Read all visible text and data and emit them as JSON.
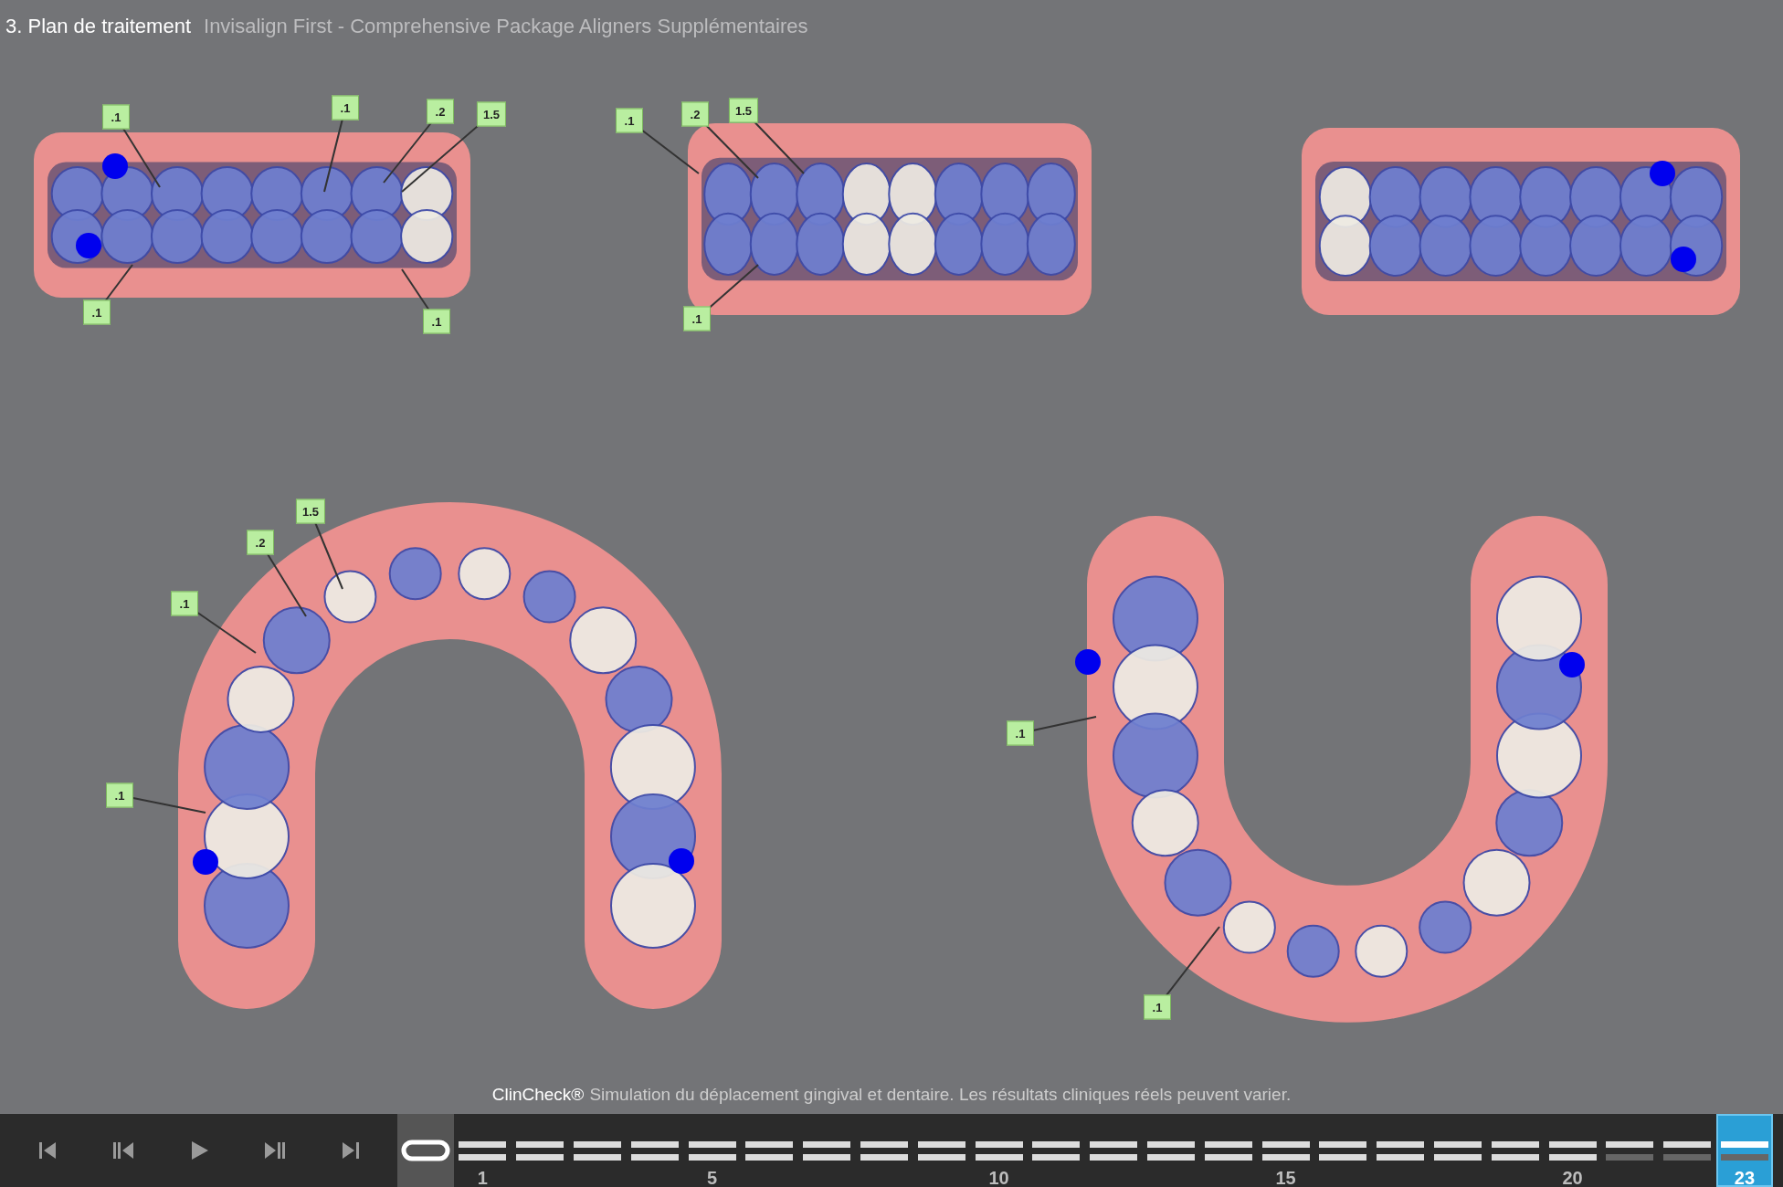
{
  "header": {
    "step": "3. Plan de traitement",
    "title": "Invisalign First - Comprehensive Package Aligners Supplémentaires"
  },
  "views": [
    {
      "kind": "side",
      "labels": [
        ".1",
        ".1",
        ".2",
        "1.5",
        ".1",
        ".1"
      ]
    },
    {
      "kind": "front",
      "labels": [
        ".1",
        ".2",
        "1.5",
        ".1"
      ]
    },
    {
      "kind": "side"
    },
    {
      "kind": "upper",
      "labels": [
        "1.5",
        ".2",
        ".1",
        ".1"
      ]
    },
    {
      "kind": "lower",
      "labels": [
        ".1",
        ".1"
      ]
    }
  ],
  "disclaimer": {
    "brand": "ClinCheck®",
    "text": "Simulation du déplacement gingival et dentaire. Les résultats cliniques réels peuvent varier."
  },
  "stages": [
    {
      "kind": "start",
      "selected": false
    },
    {
      "kind": "aligner",
      "label": "1",
      "selected": false,
      "upper": true,
      "lower": true
    },
    {
      "kind": "aligner",
      "selected": false,
      "upper": true,
      "lower": true
    },
    {
      "kind": "aligner",
      "selected": false,
      "upper": true,
      "lower": true
    },
    {
      "kind": "aligner",
      "selected": false,
      "upper": true,
      "lower": true
    },
    {
      "kind": "aligner",
      "label": "5",
      "selected": false,
      "upper": true,
      "lower": true
    },
    {
      "kind": "aligner",
      "selected": false,
      "upper": true,
      "lower": true
    },
    {
      "kind": "aligner",
      "selected": false,
      "upper": true,
      "lower": true
    },
    {
      "kind": "aligner",
      "selected": false,
      "upper": true,
      "lower": true
    },
    {
      "kind": "aligner",
      "selected": false,
      "upper": true,
      "lower": true
    },
    {
      "kind": "aligner",
      "label": "10",
      "selected": false,
      "upper": true,
      "lower": true
    },
    {
      "kind": "aligner",
      "selected": false,
      "upper": true,
      "lower": true
    },
    {
      "kind": "aligner",
      "selected": false,
      "upper": true,
      "lower": true
    },
    {
      "kind": "aligner",
      "selected": false,
      "upper": true,
      "lower": true
    },
    {
      "kind": "aligner",
      "selected": false,
      "upper": true,
      "lower": true
    },
    {
      "kind": "aligner",
      "label": "15",
      "selected": false,
      "upper": true,
      "lower": true
    },
    {
      "kind": "aligner",
      "selected": false,
      "upper": true,
      "lower": true
    },
    {
      "kind": "aligner",
      "selected": false,
      "upper": true,
      "lower": true
    },
    {
      "kind": "aligner",
      "selected": false,
      "upper": true,
      "lower": true
    },
    {
      "kind": "aligner",
      "selected": false,
      "upper": true,
      "lower": true
    },
    {
      "kind": "aligner",
      "label": "20",
      "selected": false,
      "upper": true,
      "lower": true
    },
    {
      "kind": "aligner",
      "selected": false,
      "upper": true,
      "lower": false
    },
    {
      "kind": "aligner",
      "selected": false,
      "upper": true,
      "lower": false
    },
    {
      "kind": "aligner",
      "label": "23",
      "selected": true,
      "upper": true,
      "lower": false
    }
  ]
}
